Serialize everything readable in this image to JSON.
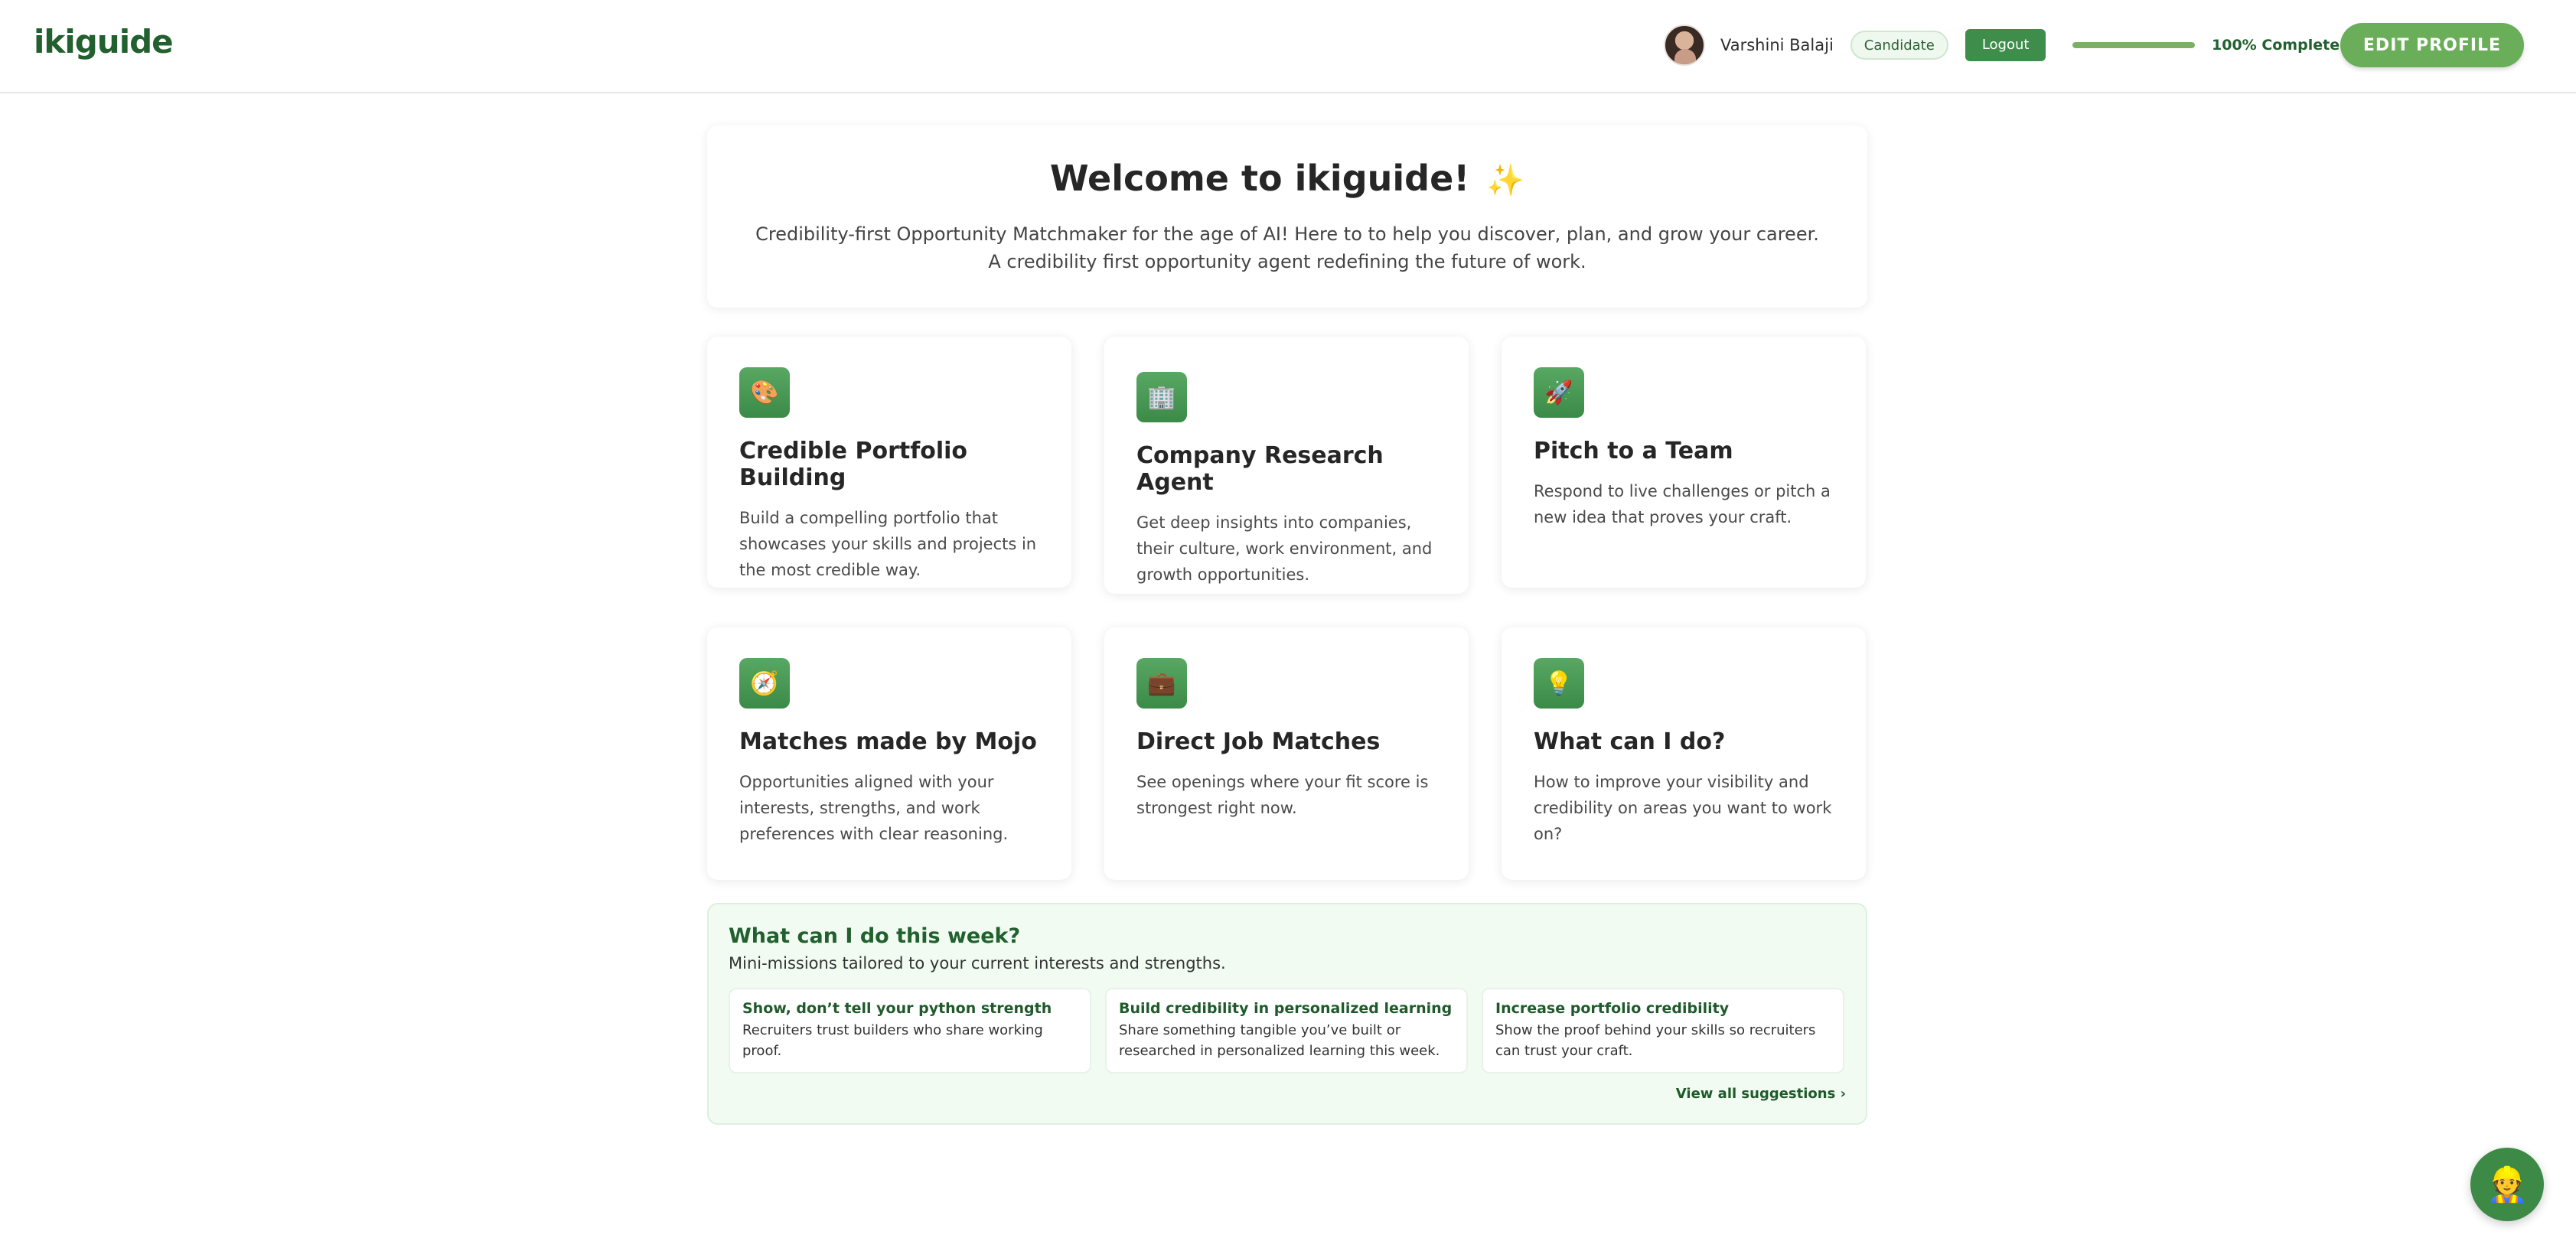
{
  "header": {
    "brand": "ikiguide",
    "user_name": "Varshini Balaji",
    "role": "Candidate",
    "logout_label": "Logout",
    "progress_fraction": 1.0,
    "progress_label": "100% Complete",
    "edit_profile_label": "EDIT PROFILE"
  },
  "welcome": {
    "title": "Welcome to ikiguide!",
    "sparkle": "✨",
    "line1": "Credibility-first Opportunity Matchmaker for the age of AI! Here to to help you discover, plan, and grow your career.",
    "line2": "A credibility first opportunity agent redefining the future of work."
  },
  "cards": [
    {
      "icon": "palette-icon",
      "glyph": "🎨",
      "title": "Credible Portfolio Building",
      "desc": "Build a compelling portfolio that showcases your skills and projects in the most credible way."
    },
    {
      "icon": "building-icon",
      "glyph": "🏢",
      "title": "Company Research Agent",
      "desc": "Get deep insights into companies, their culture, work environment, and growth opportunities."
    },
    {
      "icon": "rocket-icon",
      "glyph": "🚀",
      "title": "Pitch to a Team",
      "desc": "Respond to live challenges or pitch a new idea that proves your craft."
    },
    {
      "icon": "compass-icon",
      "glyph": "🧭",
      "title": "Matches made by Mojo",
      "desc": "Opportunities aligned with your interests, strengths, and work preferences with clear reasoning."
    },
    {
      "icon": "briefcase-icon",
      "glyph": "💼",
      "title": "Direct Job Matches",
      "desc": "See openings where your fit score is strongest right now."
    },
    {
      "icon": "lightbulb-icon",
      "glyph": "💡",
      "title": "What can I do?",
      "desc": "How to improve your visibility and credibility on areas you want to work on?"
    }
  ],
  "weekly": {
    "title": "What can I do this week?",
    "subtitle": "Mini-missions tailored to your current interests and strengths.",
    "missions": [
      {
        "title": "Show, don’t tell your python strength",
        "desc": "Recruiters trust builders who share working proof."
      },
      {
        "title": "Build credibility in personalized learning",
        "desc": "Share something tangible you’ve built or researched in personalized learning this week."
      },
      {
        "title": "Increase portfolio credibility",
        "desc": "Show the proof behind your skills so recruiters can trust your craft."
      }
    ],
    "view_all": "View all suggestions ›"
  },
  "chat": {
    "icon": "assistant-icon",
    "glyph": "👷"
  },
  "colors": {
    "brand": "#22602f",
    "accent": "#6aae5a",
    "button": "#3f8d4b",
    "weekly_bg": "#f1fbf1"
  }
}
